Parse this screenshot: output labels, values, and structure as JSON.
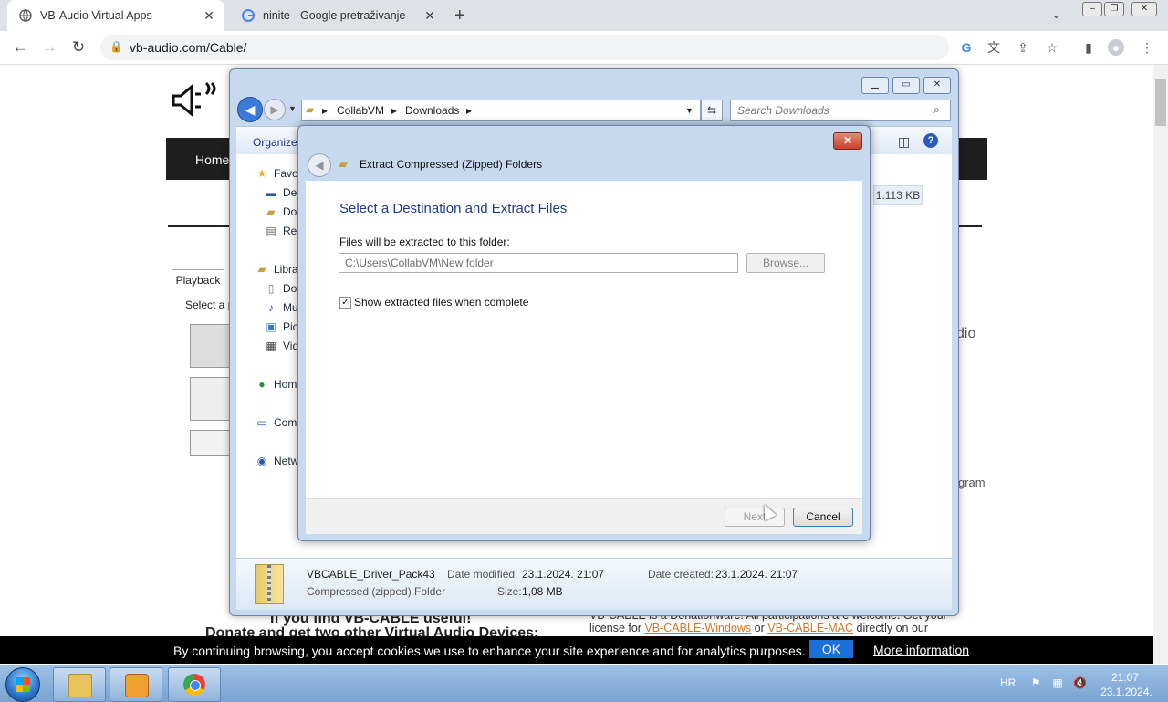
{
  "browser": {
    "tabs": [
      {
        "title": "VB-Audio Virtual Apps",
        "active": true
      },
      {
        "title": "ninite - Google pretraživanje",
        "active": false
      }
    ],
    "url": "vb-audio.com/Cable/"
  },
  "webpage": {
    "nav_home": "Home",
    "playback_tab": "Playback",
    "select_text": "Select a p",
    "right_fragment_1": "dio",
    "right_fragment_2": "gram",
    "footer_left_1": "If you find VB-CABLE useful!",
    "footer_left_2": "Donate and get two other Virtual Audio Devices:",
    "footer_right_1": "VB-CABLE is a Donationware! All participations are welcome. Get your",
    "footer_right_2_pre": "license for",
    "footer_right_2_link1": "VB-CABLE-Windows",
    "footer_right_2_mid": "or",
    "footer_right_2_link2": "VB-CABLE-MAC",
    "footer_right_2_post": "directly on our"
  },
  "cookie_bar": {
    "text": "By continuing browsing, you accept cookies we use to enhance your site experience and for analytics purposes.",
    "ok": "OK",
    "more": "More information"
  },
  "explorer": {
    "breadcrumbs": [
      "CollabVM",
      "Downloads"
    ],
    "search_placeholder": "Search Downloads",
    "organize": "Organize",
    "nav": {
      "favorites": "Favor",
      "desktop": "Des",
      "downloads": "Dov",
      "recent": "Rec",
      "libraries": "Libra",
      "documents": "Doc",
      "music": "Mu",
      "pictures": "Pic",
      "videos": "Vid",
      "homegroup": "Hom",
      "computer": "Com",
      "network": "Netw"
    },
    "size_header": "e",
    "size_value": "1.113 KB",
    "details": {
      "filename": "VBCABLE_Driver_Pack43",
      "filetype": "Compressed (zipped) Folder",
      "modified_label": "Date modified:",
      "modified_value": "23.1.2024. 21:07",
      "size_label": "Size:",
      "size_value": "1,08 MB",
      "created_label": "Date created:",
      "created_value": "23.1.2024. 21:07"
    }
  },
  "dialog": {
    "title": "Extract Compressed (Zipped) Folders",
    "heading": "Select a Destination and Extract Files",
    "folder_label": "Files will be extracted to this folder:",
    "path": "C:\\Users\\CollabVM\\New folder",
    "browse": "Browse...",
    "show_files_label": "Show extracted files when complete",
    "show_files_checked": true,
    "next": "Next",
    "cancel": "Cancel"
  },
  "taskbar": {
    "language": "HR",
    "time": "21:07",
    "date": "23.1.2024."
  }
}
